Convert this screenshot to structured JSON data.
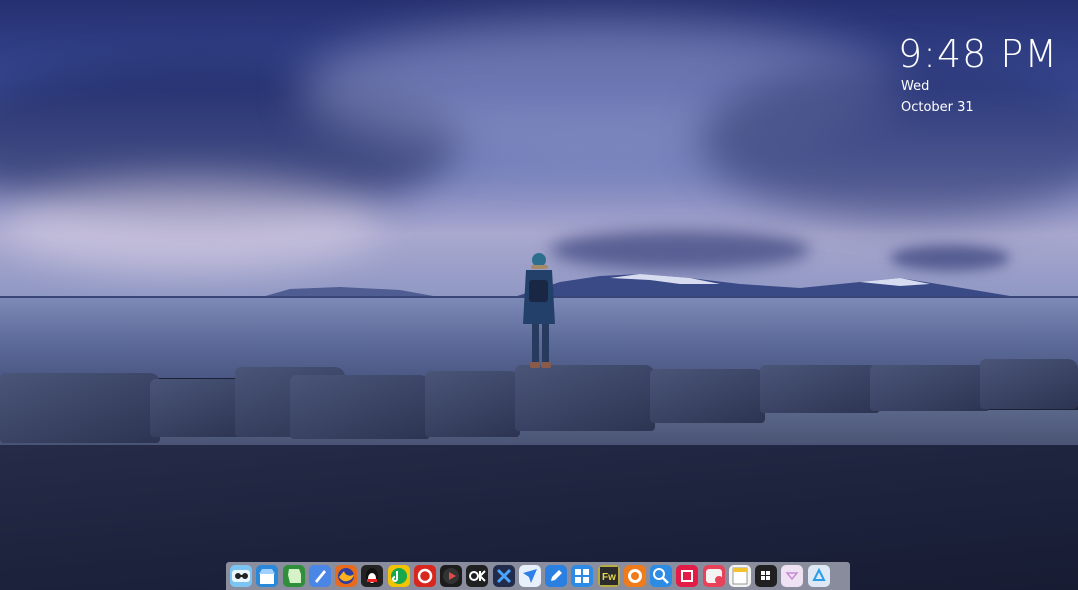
{
  "clock": {
    "time": "9:48 PM",
    "day": "Wed",
    "date": "October 31"
  },
  "dock": {
    "apps": [
      {
        "name": "finder-icon",
        "color": "#7cc5f2",
        "glyph": ""
      },
      {
        "name": "store-icon",
        "color": "#2a88d8",
        "glyph": ""
      },
      {
        "name": "evernote-icon",
        "color": "#2f8f3a",
        "glyph": ""
      },
      {
        "name": "launchpad-icon",
        "color": "#4a86e6",
        "glyph": ""
      },
      {
        "name": "firefox-icon",
        "color": "#e86a1d",
        "glyph": ""
      },
      {
        "name": "qq-icon",
        "color": "#222222",
        "glyph": ""
      },
      {
        "name": "music-icon",
        "color": "#f2c400",
        "glyph": ""
      },
      {
        "name": "netease-music-icon",
        "color": "#d8271e",
        "glyph": ""
      },
      {
        "name": "play-icon",
        "color": "#1c1c1c",
        "glyph": ""
      },
      {
        "name": "ok-icon",
        "color": "#202020",
        "glyph": ""
      },
      {
        "name": "app-x-icon",
        "color": "#222b4a",
        "glyph": ""
      },
      {
        "name": "bird-icon",
        "color": "#e8f0fb",
        "glyph": ""
      },
      {
        "name": "pen-icon",
        "color": "#2a7fe0",
        "glyph": ""
      },
      {
        "name": "windows-tiles-icon",
        "color": "#2d8ae6",
        "glyph": ""
      },
      {
        "name": "fireworks-icon",
        "color": "#2b2b2b",
        "glyph": "Fw"
      },
      {
        "name": "circle-app-icon",
        "color": "#f07b1b",
        "glyph": ""
      },
      {
        "name": "search-icon",
        "color": "#2c8be3",
        "glyph": ""
      },
      {
        "name": "red-app-icon",
        "color": "#e31b47",
        "glyph": ""
      },
      {
        "name": "video-app-icon",
        "color": "#e8425a",
        "glyph": ""
      },
      {
        "name": "notes-icon",
        "color": "#f4f4f4",
        "glyph": ""
      },
      {
        "name": "windows-icon",
        "color": "#202020",
        "glyph": ""
      },
      {
        "name": "downloads-icon",
        "color": "#efe2f2",
        "glyph": ""
      },
      {
        "name": "recycle-bin-icon",
        "color": "#dfe9f5",
        "glyph": ""
      }
    ]
  }
}
